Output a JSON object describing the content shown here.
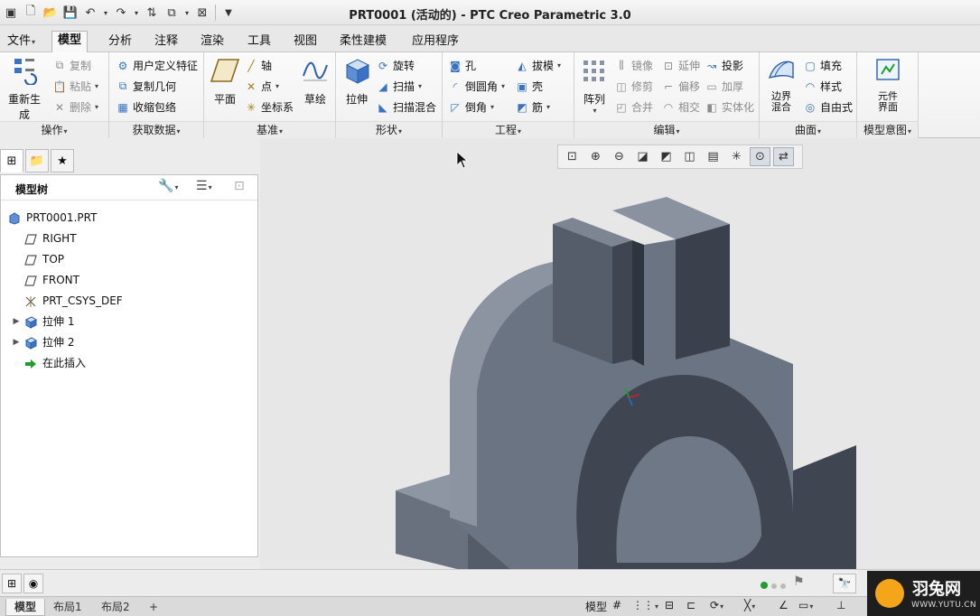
{
  "window": {
    "title": "PRT0001 (活动的) - PTC Creo Parametric 3.0"
  },
  "menu_tabs": [
    "文件",
    "模型",
    "分析",
    "注释",
    "渲染",
    "工具",
    "视图",
    "柔性建模",
    "应用程序"
  ],
  "active_tab": "模型",
  "ribbon": {
    "groups": {
      "operations": "操作",
      "get_data": "获取数据",
      "datum": "基准",
      "shapes": "形状",
      "engineering": "工程",
      "editing": "编辑",
      "surfaces": "曲面",
      "model_intent": "模型意图"
    },
    "operations": {
      "regenerate": "重新生成",
      "copy": "复制",
      "paste": "粘贴",
      "delete": "删除"
    },
    "get_data": {
      "udf": "用户定义特征",
      "copy_geom": "复制几何",
      "shrinkwrap": "收缩包络"
    },
    "datum": {
      "plane": "平面",
      "axis": "轴",
      "point": "点",
      "csys": "坐标系",
      "sketch": "草绘"
    },
    "shapes": {
      "extrude": "拉伸",
      "revolve": "旋转",
      "sweep": "扫描",
      "swept_blend": "扫描混合"
    },
    "engineering": {
      "hole": "孔",
      "round": "倒圆角",
      "chamfer": "倒角",
      "draft": "拔模",
      "shell": "壳",
      "rib": "筋"
    },
    "editing": {
      "pattern": "阵列",
      "mirror": "镜像",
      "trim": "修剪",
      "merge": "合并",
      "extend": "延伸",
      "offset": "偏移",
      "intersect": "相交",
      "project": "投影",
      "thicken": "加厚",
      "solidify": "实体化"
    },
    "surfaces": {
      "boundary_blend": "边界混合",
      "fill": "填充",
      "style": "样式",
      "freestyle": "自由式"
    },
    "model_intent": {
      "component_interface": "元件界面"
    }
  },
  "model_tree": {
    "title": "模型树",
    "items": [
      {
        "label": "PRT0001.PRT",
        "icon": "part-icon",
        "indent": 0,
        "expandable": false
      },
      {
        "label": "RIGHT",
        "icon": "datum-plane-icon",
        "indent": 1,
        "expandable": false
      },
      {
        "label": "TOP",
        "icon": "datum-plane-icon",
        "indent": 1,
        "expandable": false
      },
      {
        "label": "FRONT",
        "icon": "datum-plane-icon",
        "indent": 1,
        "expandable": false
      },
      {
        "label": "PRT_CSYS_DEF",
        "icon": "csys-icon",
        "indent": 1,
        "expandable": false
      },
      {
        "label": "拉伸 1",
        "icon": "extrude-feature-icon",
        "indent": 1,
        "expandable": true
      },
      {
        "label": "拉伸 2",
        "icon": "extrude-feature-icon",
        "indent": 1,
        "expandable": true
      },
      {
        "label": "在此插入",
        "icon": "insert-here-icon",
        "indent": 1,
        "expandable": false
      }
    ]
  },
  "bottom_tabs": [
    "模型",
    "布局1",
    "布局2"
  ],
  "add_tab": "+",
  "status_right": {
    "filter_label": "模型"
  },
  "watermark": {
    "name": "羽兔网",
    "url": "WWW.YUTU.CN"
  },
  "colors": {
    "model_face": "#6b7483",
    "model_dark": "#3f4652",
    "viewport_bg": "#e7e7e7",
    "accent_green": "#1f9d2f"
  }
}
